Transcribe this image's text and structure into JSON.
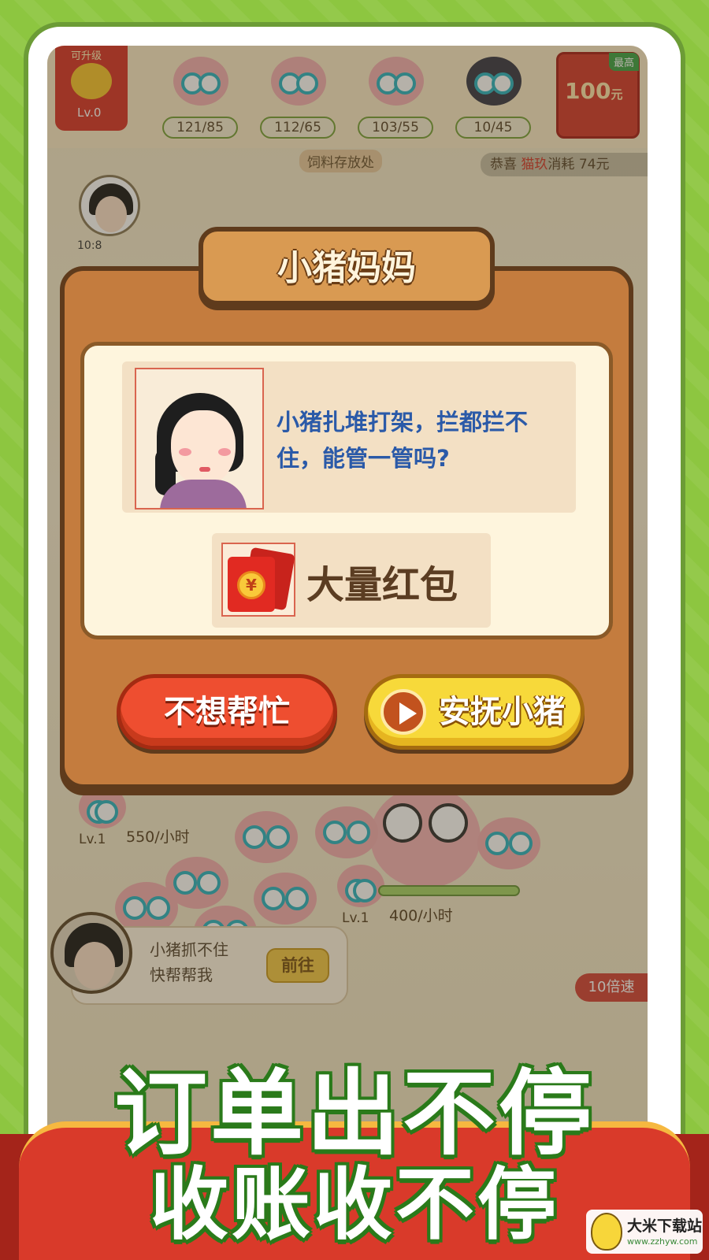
{
  "topbar": {
    "player_upgrade": "可升级",
    "player_level": "Lv.0",
    "pig_counts": [
      "121/85",
      "112/65",
      "103/55",
      "10/45"
    ],
    "redpack_best_label": "最高",
    "redpack_amount": "100",
    "redpack_unit": "元",
    "feed_storage_label": "饲料存放处",
    "ticker_prefix": "恭喜",
    "ticker_user": "猫玖",
    "ticker_suffix": "消耗",
    "ticker_amount": "74元",
    "avatar_time": "10:8"
  },
  "dialog": {
    "title": "小猪妈妈",
    "speech": "小猪扎堆打架，拦都拦不住，能管一管吗?",
    "reward_label": "大量红包",
    "coin_symbol": "¥",
    "decline_button": "不想帮忙",
    "soothe_button": "安抚小猪"
  },
  "scene": {
    "pen1_level": "Lv.1",
    "pen1_rate": "550/小时",
    "pen2_level": "Lv.1",
    "pen2_rate": "400/小时",
    "help_line1": "小猪抓不住",
    "help_line2": "快帮帮我",
    "go_button": "前往",
    "speed_badge": "10倍速"
  },
  "promo": {
    "slogan_line1": "订单出不停",
    "slogan_line2": "收账收不停"
  },
  "watermark": {
    "site_name": "大米下载站",
    "site_url": "www.zzhyw.com"
  },
  "colors": {
    "background_green": "#8dc640",
    "dialog_brown": "#c47c3e",
    "decline_red": "#ee4e30",
    "soothe_yellow": "#f7d93a",
    "speech_blue": "#2b5aa8"
  }
}
